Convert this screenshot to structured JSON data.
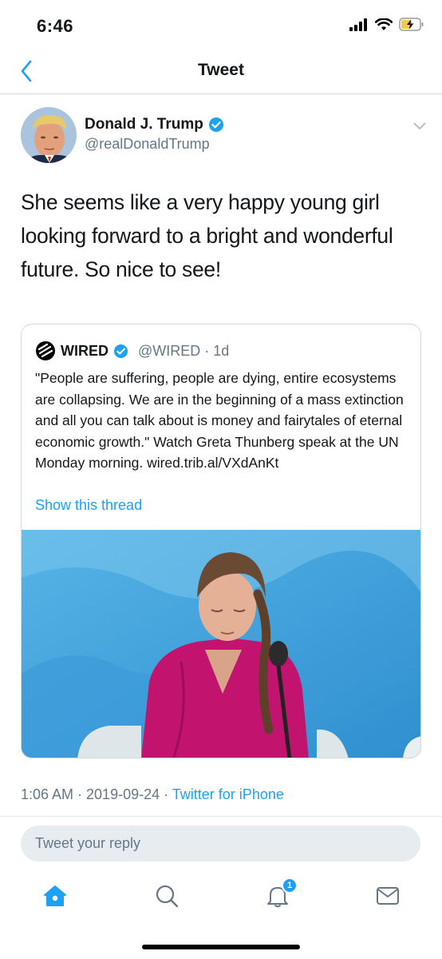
{
  "status_bar": {
    "time": "6:46"
  },
  "nav": {
    "title": "Tweet"
  },
  "tweet": {
    "author_name": "Donald J. Trump",
    "author_handle": "@realDonaldTrump",
    "text": "She seems like a very happy young girl looking forward to a bright and wonderful future. So nice to see!",
    "timestamp": "1:06 AM · 2019-09-24 · ",
    "source": "Twitter for iPhone"
  },
  "quote": {
    "name": "WIRED",
    "handle_time": "@WIRED · 1d",
    "text": "\"People are suffering, people are dying, entire ecosystems are collapsing. We are in the beginning of a mass extinction and all you can talk about is money and fairytales of eternal economic growth.\" Watch Greta Thunberg speak at the UN Monday morning. wired.trib.al/VXdAnKt",
    "show_thread": "Show this thread"
  },
  "reply": {
    "placeholder": "Tweet your reply"
  },
  "tabbar": {
    "items": [
      "home-icon",
      "search-icon",
      "notifications-icon",
      "messages-icon"
    ],
    "notification_count": "1"
  },
  "colors": {
    "accent": "#1da1f2",
    "muted": "#657786",
    "text": "#14171a"
  }
}
